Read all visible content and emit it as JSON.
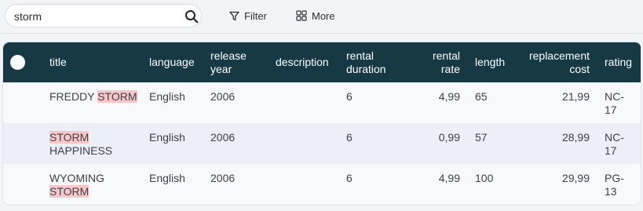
{
  "search": {
    "value": "storm"
  },
  "toolbar": {
    "filter_label": "Filter",
    "more_label": "More"
  },
  "table": {
    "headers": {
      "title": "title",
      "language": "language",
      "release_year": "release year",
      "description": "description",
      "rental_duration": "rental duration",
      "rental_rate": "rental rate",
      "length": "length",
      "replacement_cost": "replacement cost",
      "rating": "rating"
    },
    "rows": [
      {
        "title_parts": [
          {
            "text": "FREDDY ",
            "highlight": false
          },
          {
            "text": "STORM",
            "highlight": true
          }
        ],
        "language": "English",
        "release_year": "2006",
        "description": "",
        "rental_duration": "6",
        "rental_rate": "4,99",
        "length": "65",
        "replacement_cost": "21,99",
        "rating": "NC-17"
      },
      {
        "title_parts": [
          {
            "text": "STORM",
            "highlight": true
          },
          {
            "text": " HAPPINESS",
            "highlight": false
          }
        ],
        "language": "English",
        "release_year": "2006",
        "description": "",
        "rental_duration": "6",
        "rental_rate": "0,99",
        "length": "57",
        "replacement_cost": "28,99",
        "rating": "NC-17"
      },
      {
        "title_parts": [
          {
            "text": "WYOMING ",
            "highlight": false
          },
          {
            "text": "STORM",
            "highlight": true
          }
        ],
        "language": "English",
        "release_year": "2006",
        "description": "",
        "rental_duration": "6",
        "rental_rate": "4,99",
        "length": "100",
        "replacement_cost": "29,99",
        "rating": "PG-13"
      }
    ]
  },
  "colors": {
    "header_bg": "#173845",
    "highlight": "#f8c8c8",
    "row_alt": "#eceef8"
  },
  "icons": {
    "search": "search-icon",
    "filter": "filter-icon",
    "more": "grid-icon"
  }
}
